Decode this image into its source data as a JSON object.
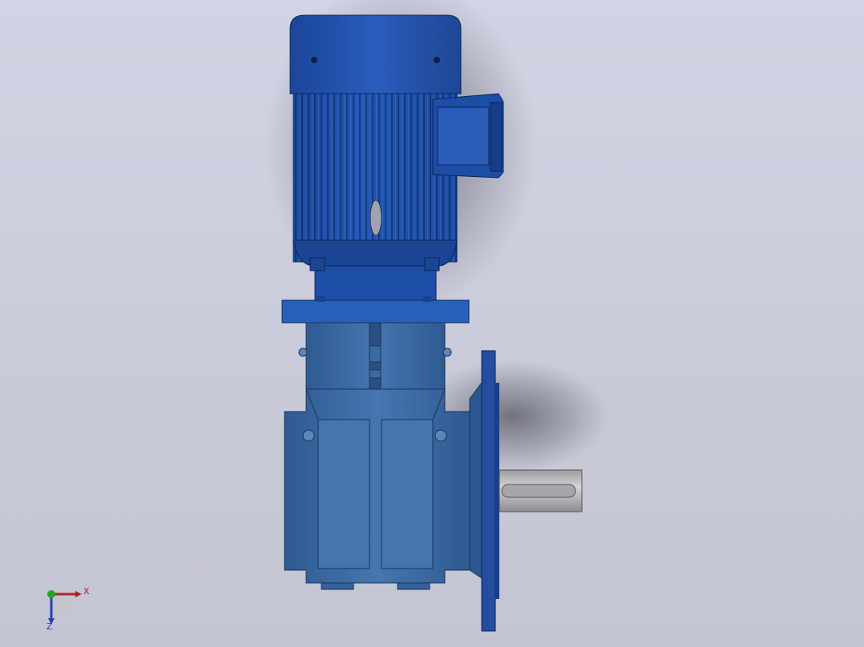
{
  "viewport": {
    "background_top": "#d2d3e4",
    "background_bottom": "#c4c5d2"
  },
  "model": {
    "type": "vertical-motor-with-bevel-gearbox",
    "colors": {
      "motor_blue": "#1e4fa8",
      "motor_blue_dark": "#143a80",
      "gearbox_blue": "#3f6ea6",
      "gearbox_blue_dark": "#2c5382",
      "shaft_gray": "#b9b9bb"
    }
  },
  "triad": {
    "x_label": "X",
    "z_label": "Z",
    "x_color": "#b0202a",
    "y_color": "#2ca02c",
    "z_color": "#2a3fb5"
  }
}
